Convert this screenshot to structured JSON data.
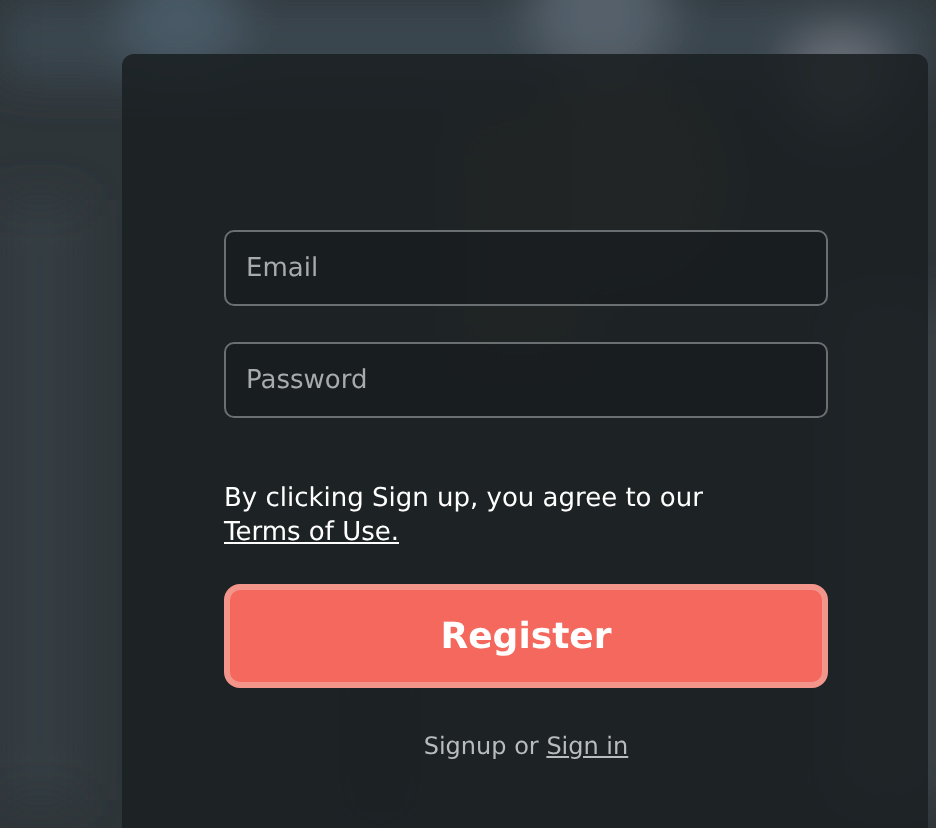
{
  "form": {
    "fields": [
      {
        "placeholder": "Email"
      },
      {
        "placeholder": "Password"
      }
    ],
    "terms": {
      "text": "By clicking Sign up, you agree to our",
      "link": "Terms of Use."
    },
    "submit": "Register",
    "footer": {
      "text": "Signup or",
      "link": "Sign in"
    }
  }
}
